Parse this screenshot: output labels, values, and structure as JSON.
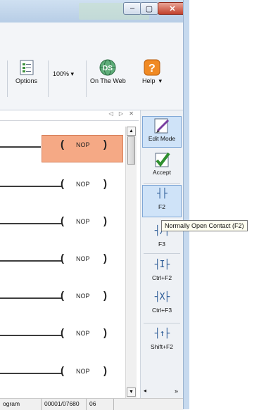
{
  "window": {
    "minimize_glyph": "–",
    "maximize_glyph": "▢",
    "close_glyph": "✕"
  },
  "ribbon": {
    "options_label": "Options",
    "zoom_value": "100%",
    "zoom_arrow": "▾",
    "web_label": "On The Web",
    "help_label": "Help",
    "help_arrow": "▾"
  },
  "panel": {
    "controls": "◁ ▷ ✕"
  },
  "ladder": {
    "instruction": "NOP",
    "open_paren": "(",
    "close_paren": ")"
  },
  "palette": {
    "edit_mode_label": "Edit Mode",
    "accept_label": "Accept",
    "items": [
      {
        "label": "F2"
      },
      {
        "label": "F3"
      },
      {
        "label": "Ctrl+F2"
      },
      {
        "label": "Ctrl+F3"
      },
      {
        "label": "Shift+F2"
      }
    ],
    "bottom_left": "◂",
    "bottom_right": "»"
  },
  "tooltip": {
    "text": "Normally Open Contact (F2)"
  },
  "status": {
    "field1": "ogram",
    "field2": "00001/07680",
    "field3": "06"
  },
  "colors": {
    "selected_rung": "#f5a985",
    "active_tool": "#cfe3f8"
  }
}
